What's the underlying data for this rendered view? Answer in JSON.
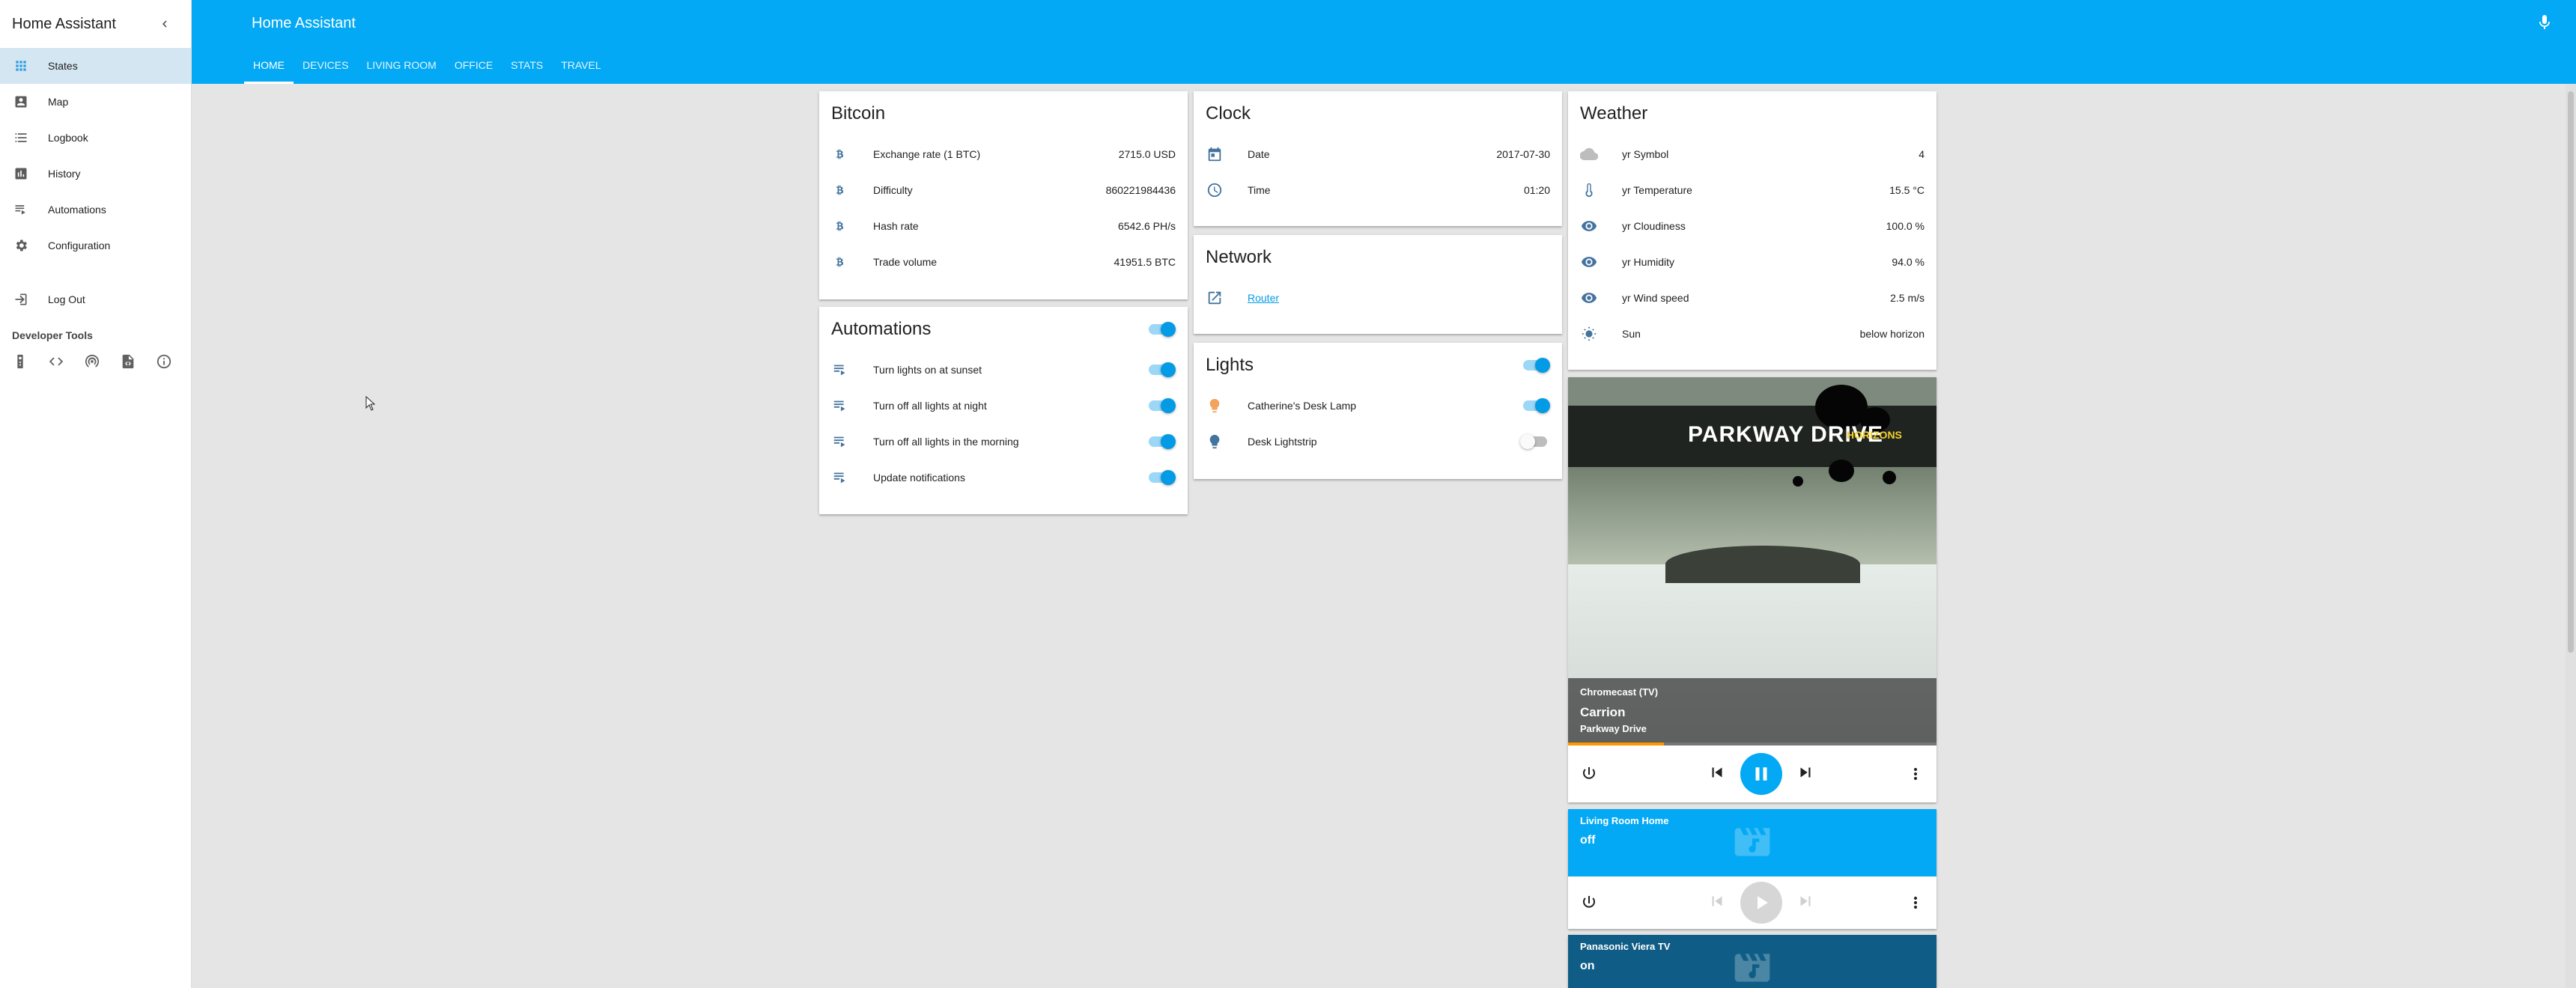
{
  "sidebar": {
    "title": "Home Assistant",
    "items": [
      {
        "label": "States",
        "icon": "grid-icon"
      },
      {
        "label": "Map",
        "icon": "map-icon"
      },
      {
        "label": "Logbook",
        "icon": "logbook-icon"
      },
      {
        "label": "History",
        "icon": "history-chart-icon"
      },
      {
        "label": "Automations",
        "icon": "automation-icon"
      },
      {
        "label": "Configuration",
        "icon": "gear-icon"
      },
      {
        "label": "Log Out",
        "icon": "exit-icon"
      }
    ],
    "dev_tools_title": "Developer Tools",
    "dev_tools": [
      "remote-icon",
      "code-icon",
      "broadcast-icon",
      "file-code-icon",
      "info-icon"
    ]
  },
  "header": {
    "title": "Home Assistant",
    "tabs": [
      "HOME",
      "DEVICES",
      "LIVING ROOM",
      "OFFICE",
      "STATS",
      "TRAVEL"
    ],
    "active_tab": "HOME"
  },
  "bitcoin": {
    "title": "Bitcoin",
    "rows": [
      {
        "name": "Exchange rate (1 BTC)",
        "value": "2715.0 USD"
      },
      {
        "name": "Difficulty",
        "value": "860221984436"
      },
      {
        "name": "Hash rate",
        "value": "6542.6 PH/s"
      },
      {
        "name": "Trade volume",
        "value": "41951.5 BTC"
      }
    ]
  },
  "automations": {
    "title": "Automations",
    "rows": [
      {
        "name": "Turn lights on at sunset",
        "on": true
      },
      {
        "name": "Turn off all lights at night",
        "on": true
      },
      {
        "name": "Turn off all lights in the morning",
        "on": true
      },
      {
        "name": "Update notifications",
        "on": true
      }
    ]
  },
  "clock": {
    "title": "Clock",
    "rows": [
      {
        "name": "Date",
        "value": "2017-07-30"
      },
      {
        "name": "Time",
        "value": "01:20"
      }
    ]
  },
  "network": {
    "title": "Network",
    "link": "Router"
  },
  "lights": {
    "title": "Lights",
    "rows": [
      {
        "name": "Catherine's Desk Lamp",
        "on": true,
        "color": "#f2a35c"
      },
      {
        "name": "Desk Lightstrip",
        "on": false,
        "color": "#44739e"
      }
    ]
  },
  "weather": {
    "title": "Weather",
    "rows": [
      {
        "name": "yr Symbol",
        "value": "4"
      },
      {
        "name": "yr Temperature",
        "value": "15.5 °C"
      },
      {
        "name": "yr Cloudiness",
        "value": "100.0 %"
      },
      {
        "name": "yr Humidity",
        "value": "94.0 %"
      },
      {
        "name": "yr Wind speed",
        "value": "2.5 m/s"
      },
      {
        "name": "Sun",
        "value": "below horizon"
      }
    ]
  },
  "media": {
    "chromecast": {
      "source": "Chromecast (TV)",
      "track": "Carrion",
      "artist": "Parkway Drive",
      "art_band": "PARKWAY DRIVE",
      "art_album": "HORIZONS",
      "progress": 0.26
    },
    "living_room": {
      "source": "Living Room Home",
      "state": "off",
      "color": "#03a9f4"
    },
    "panasonic": {
      "source": "Panasonic Viera TV",
      "state": "on",
      "color": "#0f5d86"
    }
  },
  "colors": {
    "accent": "#03a9f4",
    "icon": "#44739e",
    "toggle_on": "#039be5"
  }
}
